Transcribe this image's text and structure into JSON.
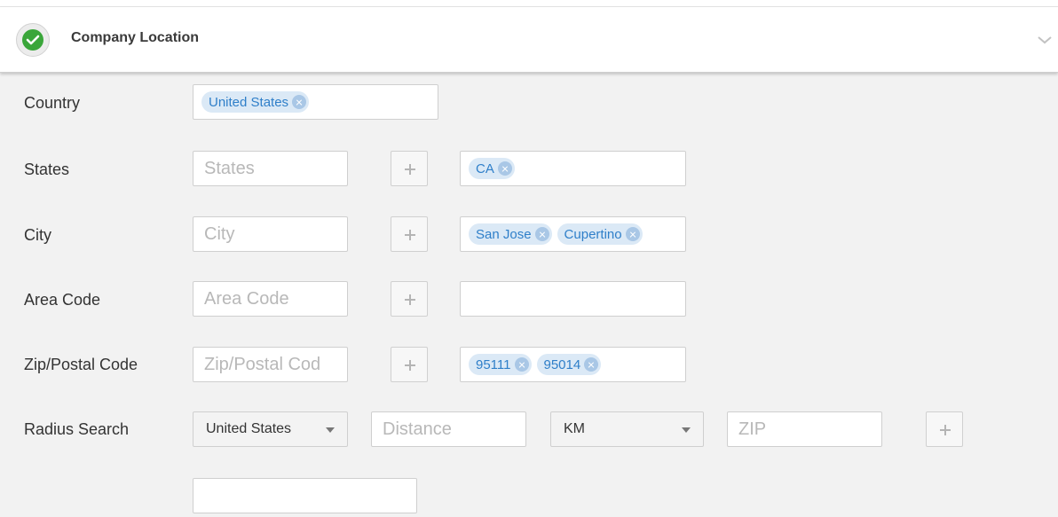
{
  "section": {
    "title": "Company Location",
    "status_icon": "check-circle-icon",
    "collapse_icon": "chevron-down-icon"
  },
  "country": {
    "label": "Country",
    "tags": [
      "United States"
    ]
  },
  "states": {
    "label": "States",
    "placeholder": "States",
    "tags": [
      "CA"
    ]
  },
  "city": {
    "label": "City",
    "placeholder": "City",
    "tags": [
      "San Jose",
      "Cupertino"
    ]
  },
  "area_code": {
    "label": "Area Code",
    "placeholder": "Area Code",
    "tags": []
  },
  "zip": {
    "label": "Zip/Postal Code",
    "placeholder": "Zip/Postal Cod",
    "tags": [
      "95111",
      "95014"
    ]
  },
  "radius": {
    "label": "Radius Search",
    "country_select": "United States",
    "distance_placeholder": "Distance",
    "unit_select": "KM",
    "zip_placeholder": "ZIP"
  },
  "colors": {
    "accent_green": "#3aa63a",
    "tag_bg": "#dbe9f6",
    "tag_text": "#2f7fc9",
    "panel_bg": "#f2f2f2"
  }
}
